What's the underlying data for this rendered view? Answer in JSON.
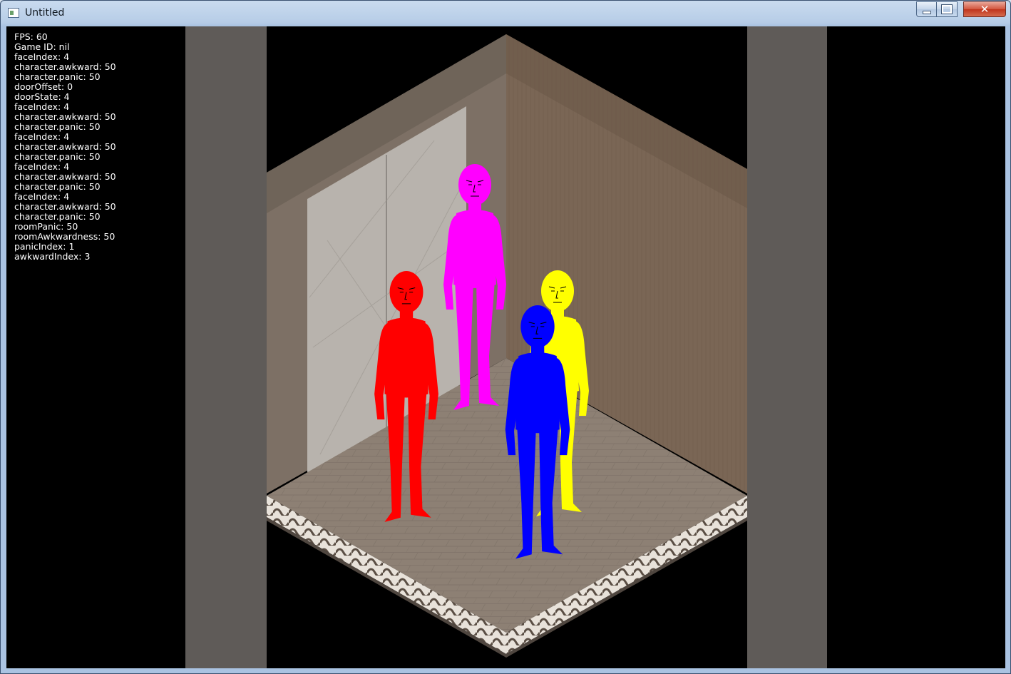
{
  "window": {
    "title": "Untitled",
    "icon": "app-window-icon",
    "controls": [
      "minimize",
      "maximize",
      "close"
    ]
  },
  "debug_lines": [
    "FPS: 60",
    "Game ID: nil",
    "faceIndex: 4",
    "character.awkward: 50",
    "character.panic: 50",
    "doorOffset: 0",
    "doorState: 4",
    "faceIndex: 4",
    "character.awkward: 50",
    "character.panic: 50",
    "faceIndex: 4",
    "character.awkward: 50",
    "character.panic: 50",
    "faceIndex: 4",
    "character.awkward: 50",
    "character.panic: 50",
    "faceIndex: 4",
    "character.awkward: 50",
    "character.panic: 50",
    "roomPanic: 50",
    "roomAwkwardness: 50",
    "panicIndex: 1",
    "awkwardIndex: 3"
  ],
  "scene": {
    "characters": [
      {
        "color": "#ff00ff",
        "name": "magenta"
      },
      {
        "color": "#ffff00",
        "name": "yellow"
      },
      {
        "color": "#ff0000",
        "name": "red"
      },
      {
        "color": "#0000ff",
        "name": "blue"
      }
    ],
    "colors": {
      "pillar": "#5f5b58",
      "left_wall": "#7d7065",
      "right_wall": "#7a6655",
      "floor": "#8d8074",
      "door": "#b8b3ad"
    }
  }
}
